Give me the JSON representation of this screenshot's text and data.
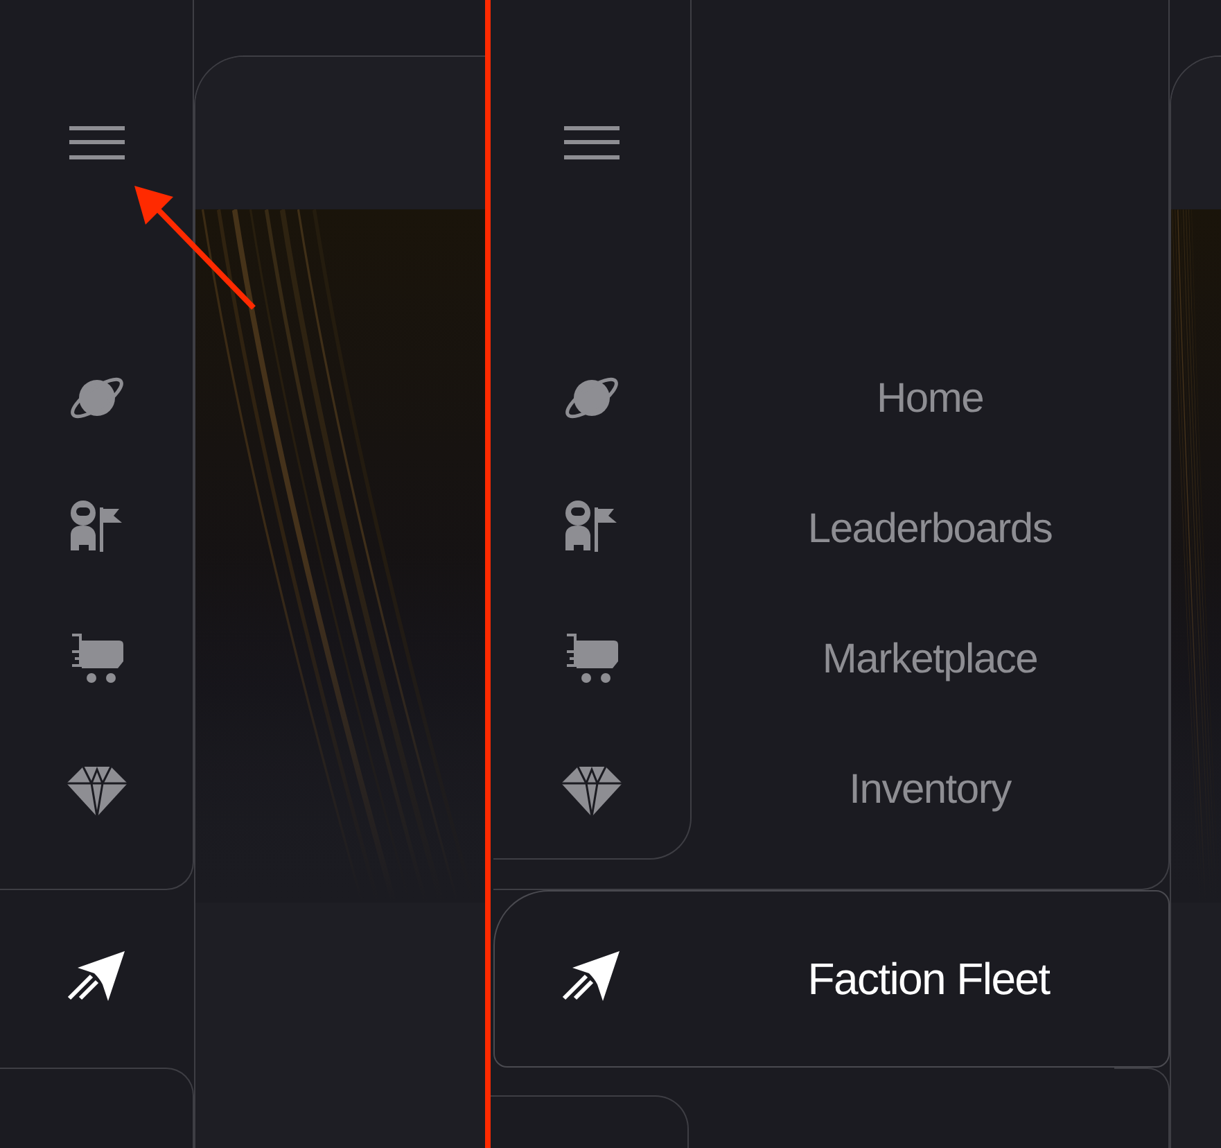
{
  "views": [
    {
      "expanded": false,
      "items": [
        {
          "kind": "home",
          "selected": false
        },
        {
          "kind": "leaderboards",
          "selected": false
        },
        {
          "kind": "marketplace",
          "selected": false
        },
        {
          "kind": "inventory",
          "selected": false
        },
        {
          "kind": "fleet",
          "selected": true
        }
      ]
    },
    {
      "expanded": true,
      "items": [
        {
          "kind": "home",
          "label": "Home",
          "selected": false
        },
        {
          "kind": "leaderboards",
          "label": "Leaderboards",
          "selected": false
        },
        {
          "kind": "marketplace",
          "label": "Marketplace",
          "selected": false
        },
        {
          "kind": "inventory",
          "label": "Inventory",
          "selected": false
        },
        {
          "kind": "fleet",
          "label": "Faction Fleet",
          "selected": true
        }
      ]
    }
  ]
}
